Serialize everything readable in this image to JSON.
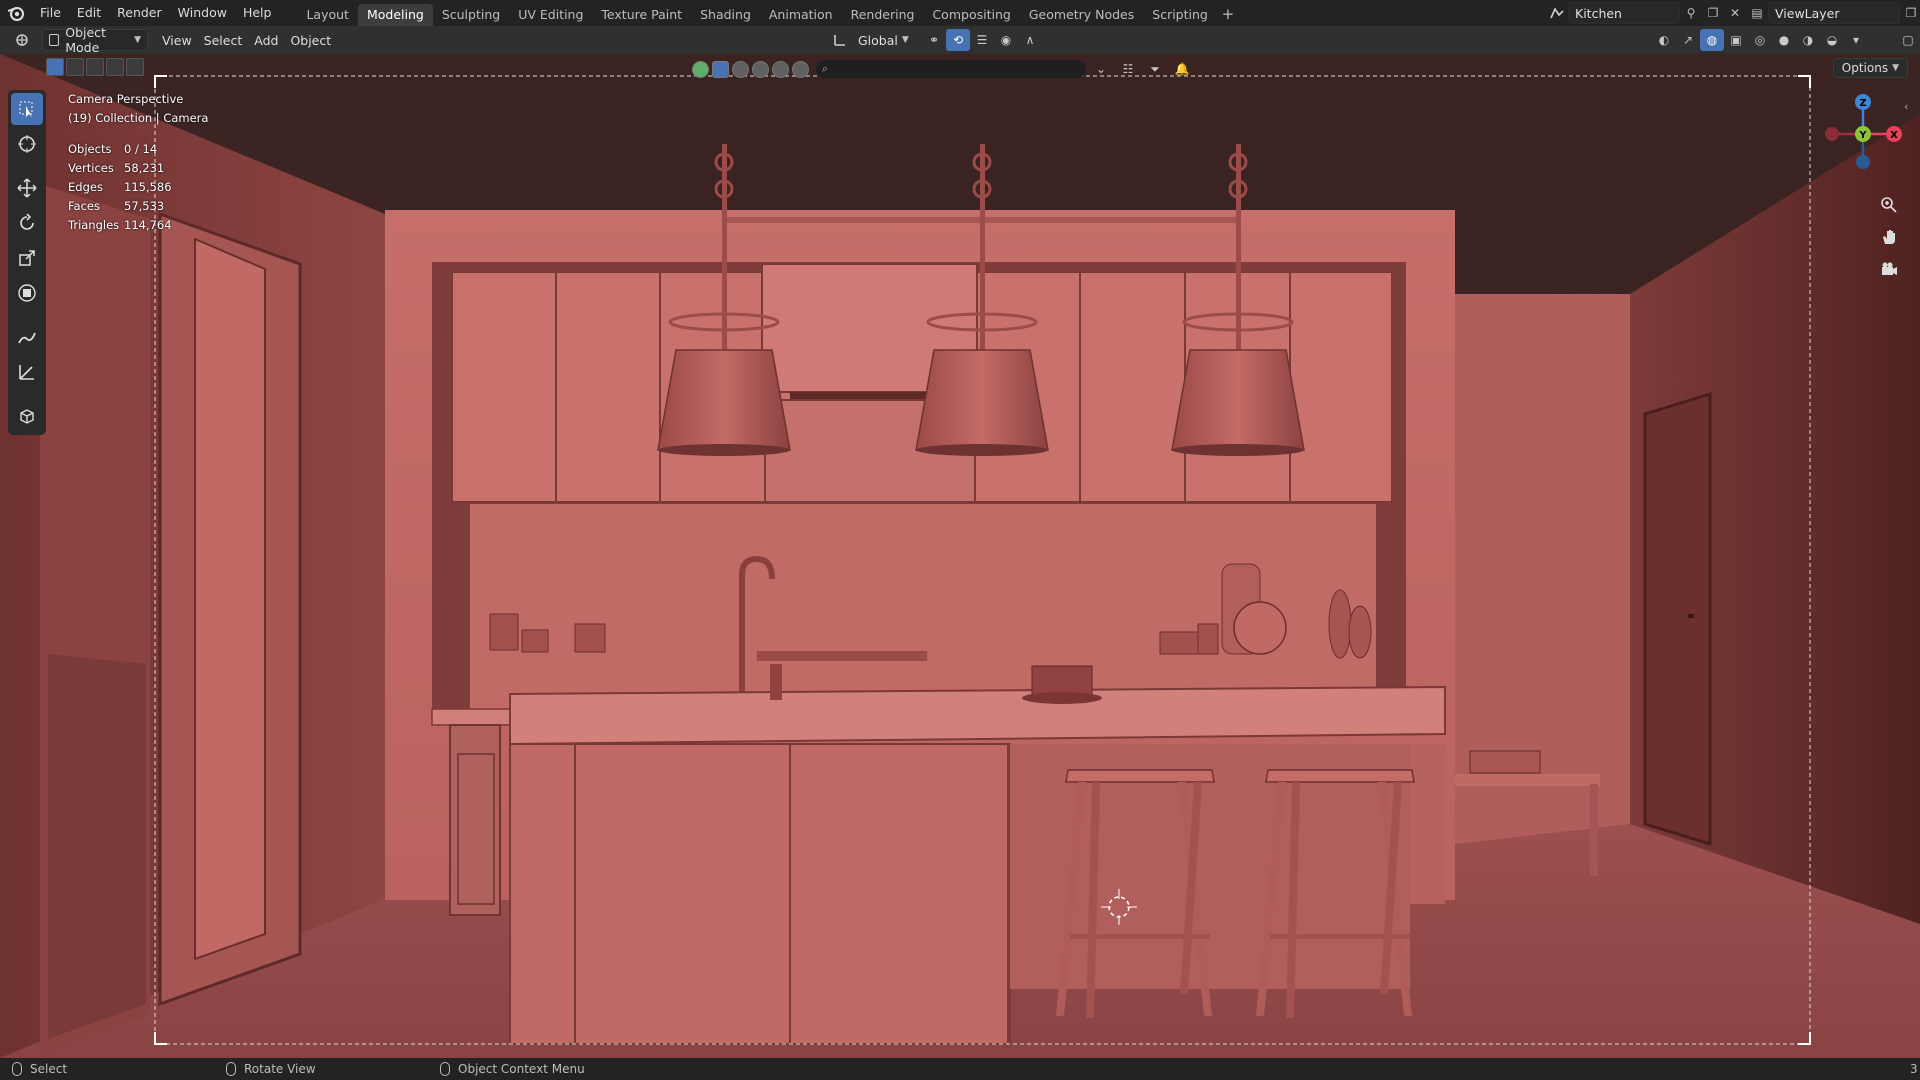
{
  "menu": {
    "items": [
      "File",
      "Edit",
      "Render",
      "Window",
      "Help"
    ]
  },
  "workspaces": {
    "tabs": [
      "Layout",
      "Modeling",
      "Sculpting",
      "UV Editing",
      "Texture Paint",
      "Shading",
      "Animation",
      "Rendering",
      "Compositing",
      "Geometry Nodes",
      "Scripting"
    ],
    "active": "Modeling",
    "add_label": "+"
  },
  "scene": {
    "name": "Kitchen"
  },
  "view_layer": {
    "name": "ViewLayer"
  },
  "viewport_header": {
    "mode": "Object Mode",
    "menus": [
      "View",
      "Select",
      "Add",
      "Object"
    ],
    "transform_orientation": "Global",
    "options_label": "Options"
  },
  "overlay": {
    "view_name": "Camera Perspective",
    "collection_line": "(19) Collection | Camera",
    "stats": [
      {
        "label": "Objects",
        "value": "0 / 14"
      },
      {
        "label": "Vertices",
        "value": "58,231"
      },
      {
        "label": "Edges",
        "value": "115,586"
      },
      {
        "label": "Faces",
        "value": "57,533"
      },
      {
        "label": "Triangles",
        "value": "114,764"
      }
    ]
  },
  "gizmo": {
    "x": "X",
    "y": "Y",
    "z": "Z"
  },
  "statusbar": {
    "left": "Select",
    "middle": "Rotate View",
    "right": "Object Context Menu",
    "corner": "3"
  },
  "colors": {
    "accent": "#4772b3",
    "axis_x": "#e8415a",
    "axis_y": "#8fc43a",
    "axis_z": "#3e86d6",
    "scene_base": "#c46f6a"
  }
}
